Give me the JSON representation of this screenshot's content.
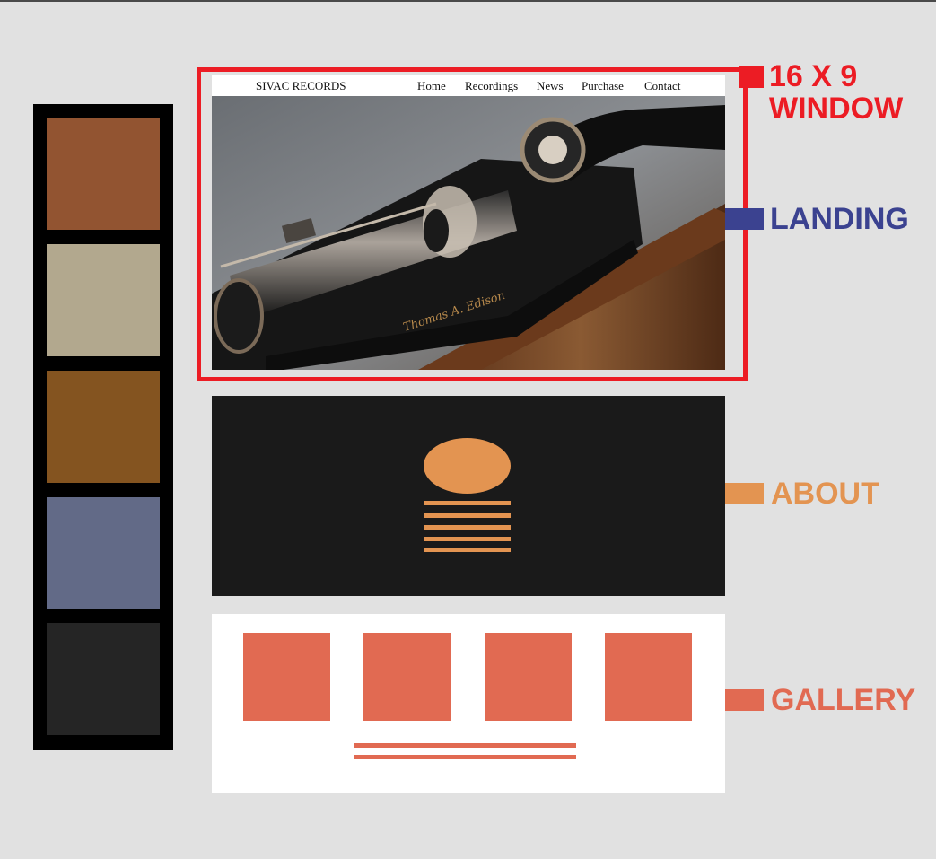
{
  "palette": {
    "swatches": [
      "#925431",
      "#b2a88e",
      "#845420",
      "#626a87",
      "#252525"
    ]
  },
  "landing": {
    "brand": "SIVAC RECORDS",
    "nav": [
      "Home",
      "Recordings",
      "News",
      "Purchase",
      "Contact"
    ],
    "hero_image": "Edison phonograph photo",
    "engraving": "Thomas A. Edison"
  },
  "labels": {
    "window_line1": "16 X 9",
    "window_line2": "WINDOW",
    "landing": "LANDING",
    "about": "ABOUT",
    "gallery": "GALLERY"
  },
  "colors": {
    "window": "#ec1c24",
    "landing": "#3b4290",
    "about": "#e39451",
    "gallery": "#e16a52"
  }
}
